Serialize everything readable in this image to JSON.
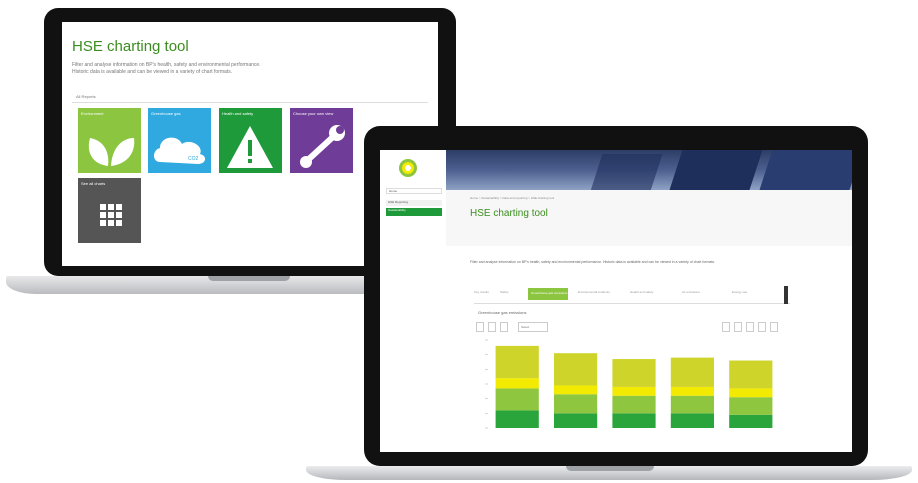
{
  "left_screen": {
    "title": "HSE charting tool",
    "description_line1": "Filter and analyse information on BP's health, safety and environmental performance.",
    "description_line2": "Historic data is available and can be viewed in a variety of chart formats.",
    "filter_chip": "All Reports",
    "tiles": [
      {
        "label": "Environment",
        "color": "#8cc540",
        "icon": "leaf-icon"
      },
      {
        "label": "Greenhouse gas",
        "color": "#2fa9e0",
        "icon": "cloud-icon",
        "icon_text": "CO2"
      },
      {
        "label": "Health and safety",
        "color": "#1f9a3b",
        "icon": "warning-icon"
      },
      {
        "label": "Choose your own view",
        "color": "#6f3c98",
        "icon": "wrench-icon"
      },
      {
        "label": "See all charts",
        "color": "#555555",
        "icon": "grid-icon"
      }
    ]
  },
  "right_screen": {
    "nav": [
      {
        "label": "Home"
      },
      {
        "label": "HSE Reporting"
      },
      {
        "label": "Sustainability"
      }
    ],
    "breadcrumb": "Home > Sustainability > Data and reporting > HSE charting tool",
    "title": "HSE charting tool",
    "description": "Filter and analyse information on BP's health, safety and environmental performance. Historic data is available and can be viewed in a variety of chart formats.",
    "tabs": [
      {
        "label": "Key results"
      },
      {
        "label": "Safety"
      },
      {
        "label": "Greenhouse gas emissions",
        "active": true
      },
      {
        "label": "Environmental incidents"
      },
      {
        "label": "Health and safety"
      },
      {
        "label": "Air emissions"
      },
      {
        "label": "Energy use"
      }
    ],
    "chart_title": "Greenhouse gas emissions",
    "select_value": "Select"
  },
  "chart_data": {
    "type": "bar",
    "stacked": true,
    "categories": [
      "",
      "",
      "",
      "",
      ""
    ],
    "series": [
      {
        "values": [
          12,
          10,
          10,
          10,
          9
        ],
        "color": "#2aa53b"
      },
      {
        "values": [
          15,
          13,
          12,
          12,
          12
        ],
        "color": "#8ec63f"
      },
      {
        "values": [
          7,
          6,
          6,
          6,
          6
        ],
        "color": "#f2ea00"
      },
      {
        "values": [
          22,
          22,
          19,
          20,
          19
        ],
        "color": "#cfd42a"
      }
    ],
    "ylim": [
      0,
      60
    ]
  }
}
